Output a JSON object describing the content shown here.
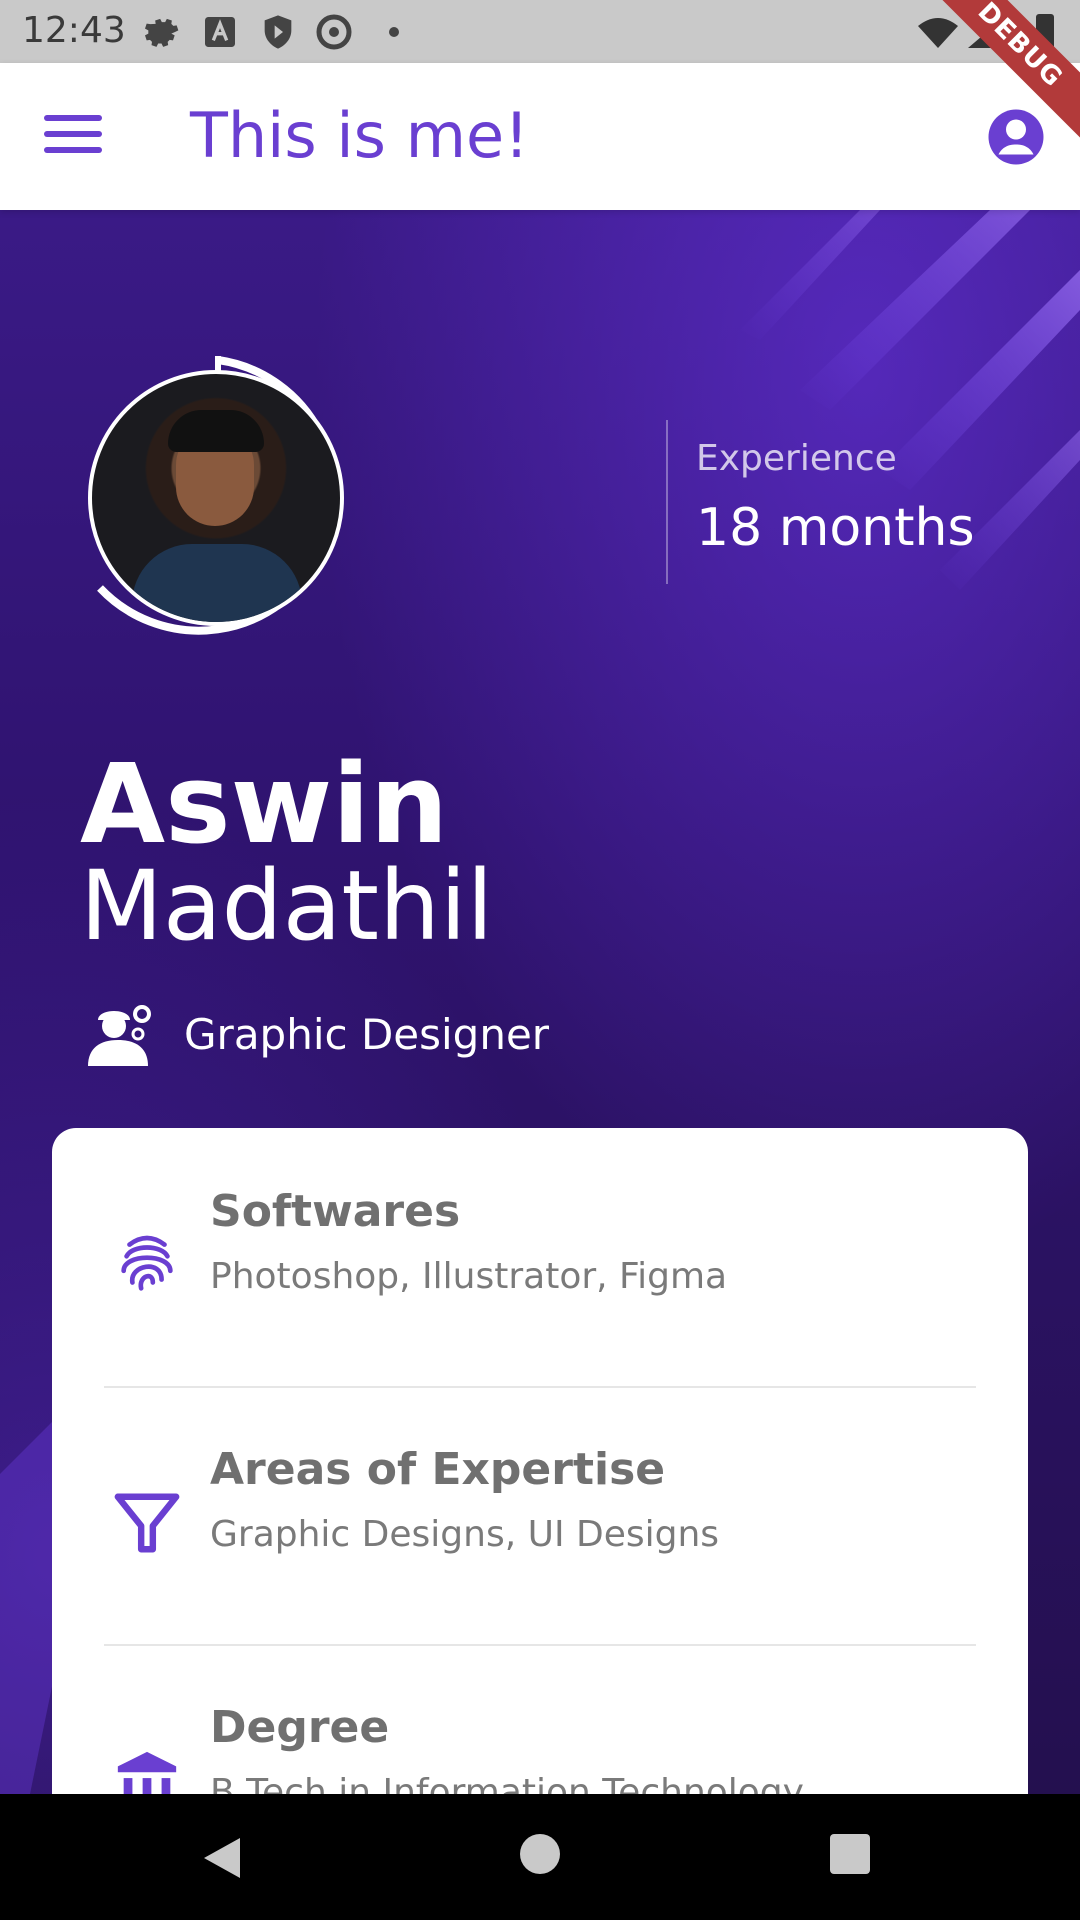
{
  "status_bar": {
    "time": "12:43",
    "icons": [
      "gear-icon",
      "a-icon",
      "shield-icon",
      "at-icon",
      "dot-icon",
      "wifi-icon",
      "signal-icon",
      "battery-icon"
    ]
  },
  "debug_banner": "DEBUG",
  "app_bar": {
    "title": "This is me!",
    "menu_icon": "menu-icon",
    "account_icon": "account-circle-icon"
  },
  "profile": {
    "first_name": "Aswin",
    "last_name": "Madathil",
    "role": "Graphic Designer",
    "experience_label": "Experience",
    "experience_value": "18 months"
  },
  "details": [
    {
      "icon": "fingerprint-icon",
      "title": "Softwares",
      "value": "Photoshop, Illustrator, Figma"
    },
    {
      "icon": "filter-icon",
      "title": "Areas of Expertise",
      "value": "Graphic Designs, UI Designs"
    },
    {
      "icon": "bank-icon",
      "title": "Degree",
      "value": "B.Tech in Information Technology"
    }
  ],
  "colors": {
    "accent": "#6a3fd1",
    "hero_top": "#3a1a86",
    "hero_bottom": "#24104f",
    "debug": "#b23a3a"
  }
}
